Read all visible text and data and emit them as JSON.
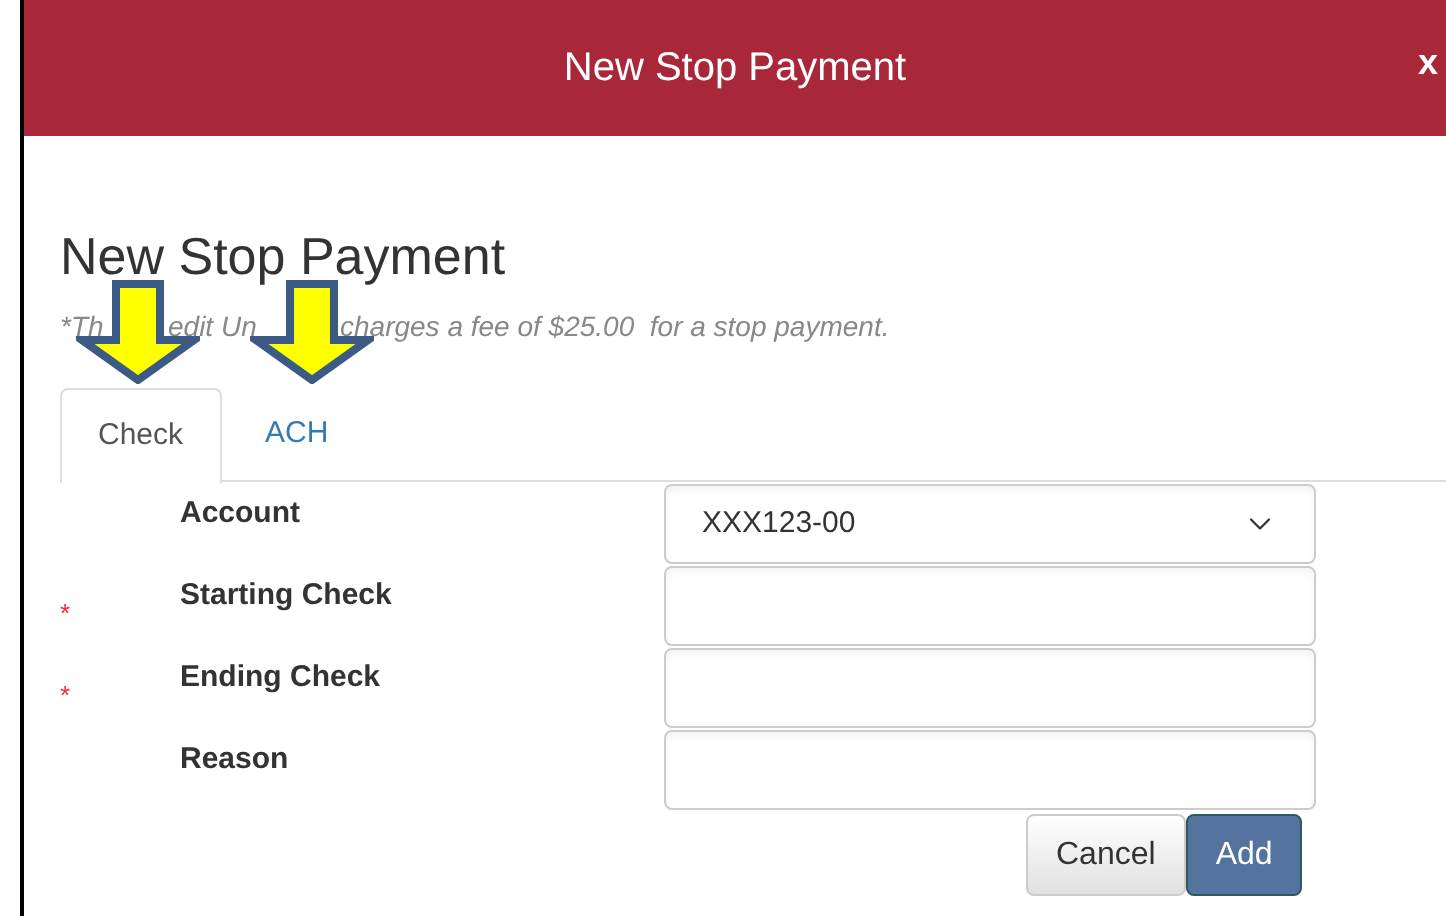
{
  "dialog": {
    "title": "New Stop Payment",
    "close": "x"
  },
  "heading": "New Stop Payment",
  "note_fragments": [
    "*Th",
    "edit Un",
    "charges a fee of $25.00  for a stop payment."
  ],
  "tabs": [
    {
      "label": "Check",
      "selected": true
    },
    {
      "label": "ACH",
      "selected": false
    }
  ],
  "fields": [
    {
      "label": "Account",
      "kind": "select",
      "required": false,
      "value": "XXX123-00"
    },
    {
      "label": "Starting Check",
      "kind": "text",
      "required": true
    },
    {
      "label": "Ending Check",
      "kind": "text",
      "required": true
    },
    {
      "label": "Reason",
      "kind": "text",
      "required": false
    }
  ],
  "required_mark": "*",
  "buttons": [
    {
      "label": "Cancel",
      "kind": "secondary"
    },
    {
      "label": "Add",
      "kind": "primary"
    }
  ]
}
